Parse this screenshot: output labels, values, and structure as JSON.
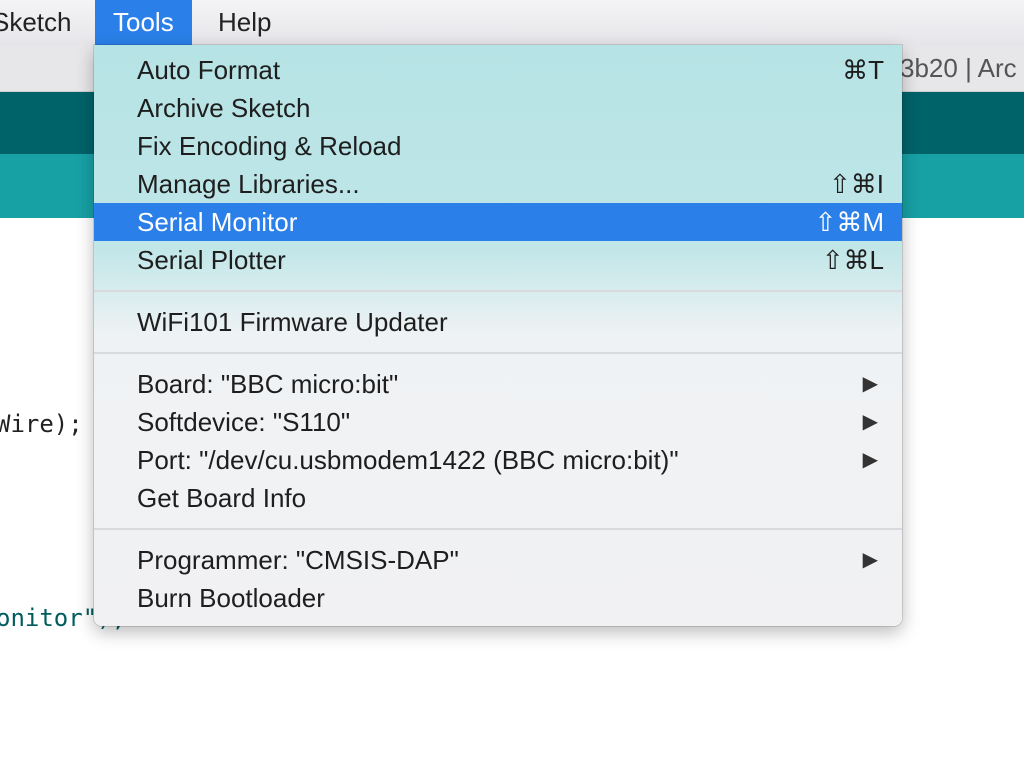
{
  "menubar": {
    "items": [
      {
        "label": "Sketch"
      },
      {
        "label": "Tools"
      },
      {
        "label": "Help"
      }
    ]
  },
  "window": {
    "title_fragment": "3b20 | Arc"
  },
  "editor": {
    "lines": [
      "Wire);",
      "onitor\");"
    ]
  },
  "tools_menu": {
    "items": [
      {
        "label": "Auto Format",
        "shortcut": "⌘T"
      },
      {
        "label": "Archive Sketch",
        "shortcut": ""
      },
      {
        "label": "Fix Encoding & Reload",
        "shortcut": ""
      },
      {
        "label": "Manage Libraries...",
        "shortcut": "⇧⌘I"
      },
      {
        "label": "Serial Monitor",
        "shortcut": "⇧⌘M",
        "selected": true
      },
      {
        "label": "Serial Plotter",
        "shortcut": "⇧⌘L"
      },
      {
        "label": "WiFi101 Firmware Updater",
        "shortcut": ""
      },
      {
        "label": "Board: \"BBC micro:bit\"",
        "submenu": true
      },
      {
        "label": "Softdevice: \"S110\"",
        "submenu": true
      },
      {
        "label": "Port: \"/dev/cu.usbmodem1422 (BBC micro:bit)\"",
        "submenu": true
      },
      {
        "label": "Get Board Info",
        "shortcut": ""
      },
      {
        "label": "Programmer: \"CMSIS-DAP\"",
        "submenu": true
      },
      {
        "label": "Burn Bootloader",
        "shortcut": ""
      }
    ],
    "submenu_arrow": "▶"
  },
  "colors": {
    "accent": "#2a7fe8",
    "toolbar": "#00636a",
    "tabbar": "#17a1a5"
  }
}
